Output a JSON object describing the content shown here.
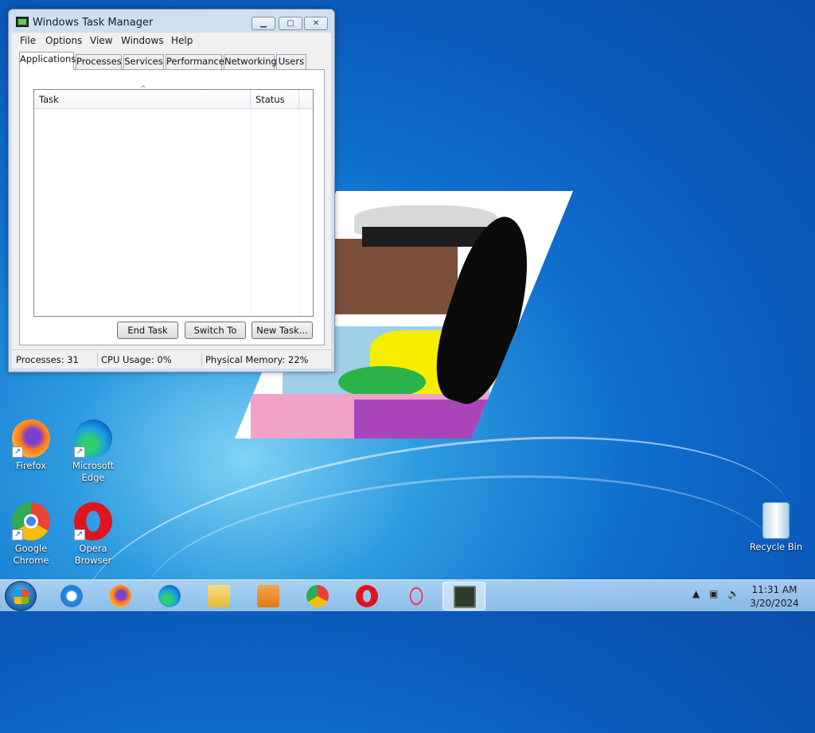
{
  "window": {
    "title": "Windows Task Manager",
    "menu": [
      "File",
      "Options",
      "View",
      "Windows",
      "Help"
    ],
    "tabs": [
      "Applications",
      "Processes",
      "Services",
      "Performance",
      "Networking",
      "Users"
    ],
    "active_tab": "Applications",
    "columns": [
      "Task",
      "Status"
    ],
    "sort_indicator": "^",
    "tasks": [],
    "buttons": {
      "end_task": "End Task",
      "switch_to": "Switch To",
      "new_task": "New Task..."
    },
    "status": {
      "processes": "Processes: 31",
      "cpu": "CPU Usage: 0%",
      "memory": "Physical Memory: 22%"
    }
  },
  "desktop_icons": [
    {
      "label": "Firefox",
      "icon": "firefox-icon"
    },
    {
      "label": "Microsoft Edge",
      "icon": "edge-icon"
    },
    {
      "label": "Google Chrome",
      "icon": "chrome-icon"
    },
    {
      "label": "Opera Browser",
      "icon": "opera-icon"
    },
    {
      "label": "Recycle Bin",
      "icon": "recycle-bin-icon"
    }
  ],
  "taskbar": {
    "pinned": [
      "internet-explorer-icon",
      "firefox-icon",
      "edge-icon",
      "file-explorer-icon",
      "media-player-icon",
      "chrome-icon",
      "opera-icon",
      "opera-gx-icon",
      "task-manager-icon"
    ],
    "clock_time": "11:31 AM",
    "clock_date": "3/20/2024"
  }
}
